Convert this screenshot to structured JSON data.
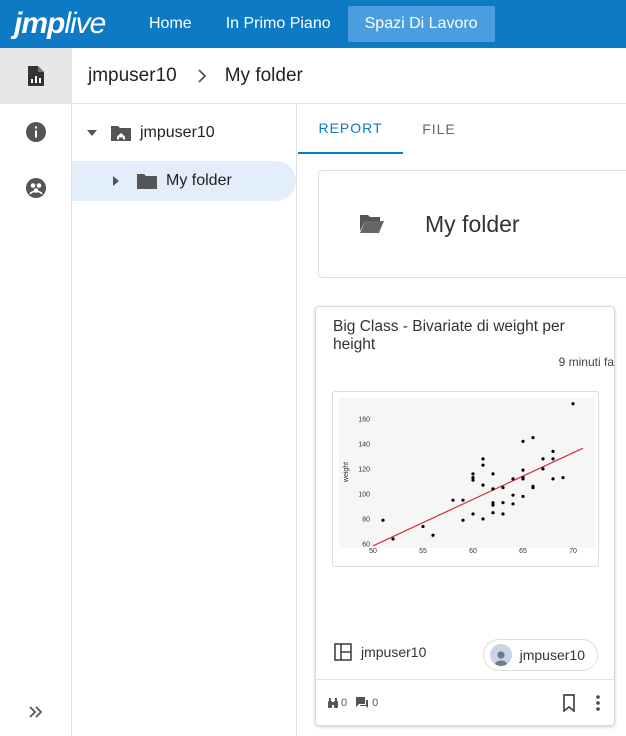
{
  "app": {
    "logo_main": "jmp",
    "logo_sub": "live",
    "brand_color": "#0d7ac6"
  },
  "nav": {
    "items": [
      {
        "label": "Home",
        "active": false
      },
      {
        "label": "In Primo Piano",
        "active": false
      },
      {
        "label": "Spazi Di Lavoro",
        "active": true
      }
    ]
  },
  "rail": {
    "items": [
      "report-icon",
      "info-icon",
      "group-icon"
    ],
    "expand_icon": "double-chevron-right-icon"
  },
  "breadcrumb": {
    "items": [
      "jmpuser10",
      "My folder"
    ]
  },
  "tree": {
    "root": {
      "label": "jmpuser10",
      "icon": "home-folder-icon"
    },
    "child": {
      "label": "My folder",
      "icon": "folder-icon",
      "selected": true
    }
  },
  "tabs": [
    {
      "label": "REPORT",
      "active": true
    },
    {
      "label": "FILE",
      "active": false
    }
  ],
  "folder_card": {
    "title": "My folder",
    "icon": "open-folder-icon"
  },
  "report_card": {
    "title": "Big Class - Bivariate di weight per height",
    "time": "9 minuti fa",
    "owner": "jmpuser10",
    "chip_user": "jmpuser10",
    "views": "0",
    "comments": "0",
    "chart_data": {
      "type": "scatter",
      "ylabel": "weight",
      "xlabel": "",
      "xlim": [
        50,
        71
      ],
      "ylim": [
        60,
        175
      ],
      "x_ticks": [
        50,
        55,
        60,
        65,
        70
      ],
      "y_ticks": [
        60,
        80,
        100,
        120,
        140,
        160
      ],
      "grid": false,
      "points": [
        [
          51,
          79
        ],
        [
          52,
          64
        ],
        [
          55,
          74
        ],
        [
          56,
          67
        ],
        [
          58,
          95
        ],
        [
          59,
          95
        ],
        [
          59,
          79
        ],
        [
          60,
          111
        ],
        [
          60,
          113
        ],
        [
          60,
          116
        ],
        [
          60,
          84
        ],
        [
          61,
          128
        ],
        [
          61,
          123
        ],
        [
          61,
          80
        ],
        [
          61,
          107
        ],
        [
          62,
          116
        ],
        [
          62,
          104
        ],
        [
          62,
          93
        ],
        [
          62,
          91
        ],
        [
          62,
          85
        ],
        [
          63,
          84
        ],
        [
          63,
          93
        ],
        [
          63,
          105
        ],
        [
          64,
          99
        ],
        [
          64,
          112
        ],
        [
          64,
          92
        ],
        [
          65,
          142
        ],
        [
          65,
          119
        ],
        [
          65,
          112
        ],
        [
          65,
          113
        ],
        [
          65,
          98
        ],
        [
          66,
          145
        ],
        [
          66,
          106
        ],
        [
          66,
          105
        ],
        [
          67,
          128
        ],
        [
          67,
          120
        ],
        [
          68,
          134
        ],
        [
          68,
          128
        ],
        [
          68,
          112
        ],
        [
          69,
          113
        ],
        [
          70,
          172
        ]
      ],
      "fit_line": [
        [
          50,
          58.5
        ],
        [
          71,
          136.5
        ]
      ],
      "fit_color": "#d0303f"
    }
  }
}
